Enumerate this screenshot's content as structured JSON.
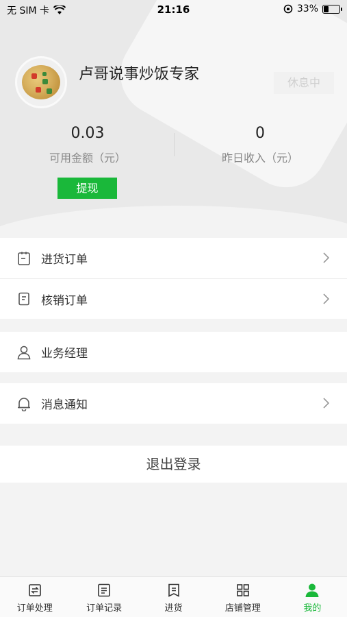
{
  "status_bar": {
    "carrier": "无 SIM 卡",
    "time": "21:16",
    "battery": "33%",
    "battery_level": 0.33
  },
  "profile": {
    "shop_name": "卢哥说事炒饭专家",
    "status": "休息中"
  },
  "stats": {
    "available_amount": "0.03",
    "available_label": "可用金额（元）",
    "yesterday_income": "0",
    "yesterday_label": "昨日收入（元）",
    "withdraw_label": "提现"
  },
  "menu": {
    "purchase_orders": "进货订单",
    "verify_orders": "核销订单",
    "business_manager": "业务经理",
    "notifications": "消息通知",
    "logout": "退出登录"
  },
  "tabbar": {
    "tabs": [
      {
        "label": "订单处理",
        "icon": "order-process-icon"
      },
      {
        "label": "订单记录",
        "icon": "order-record-icon"
      },
      {
        "label": "进货",
        "icon": "purchase-icon"
      },
      {
        "label": "店铺管理",
        "icon": "store-grid-icon"
      },
      {
        "label": "我的",
        "icon": "person-icon",
        "active": true
      }
    ],
    "active_color": "#1ab83a"
  },
  "colors": {
    "accent": "#1ab83a",
    "header_bg": "#e9e9e9"
  }
}
